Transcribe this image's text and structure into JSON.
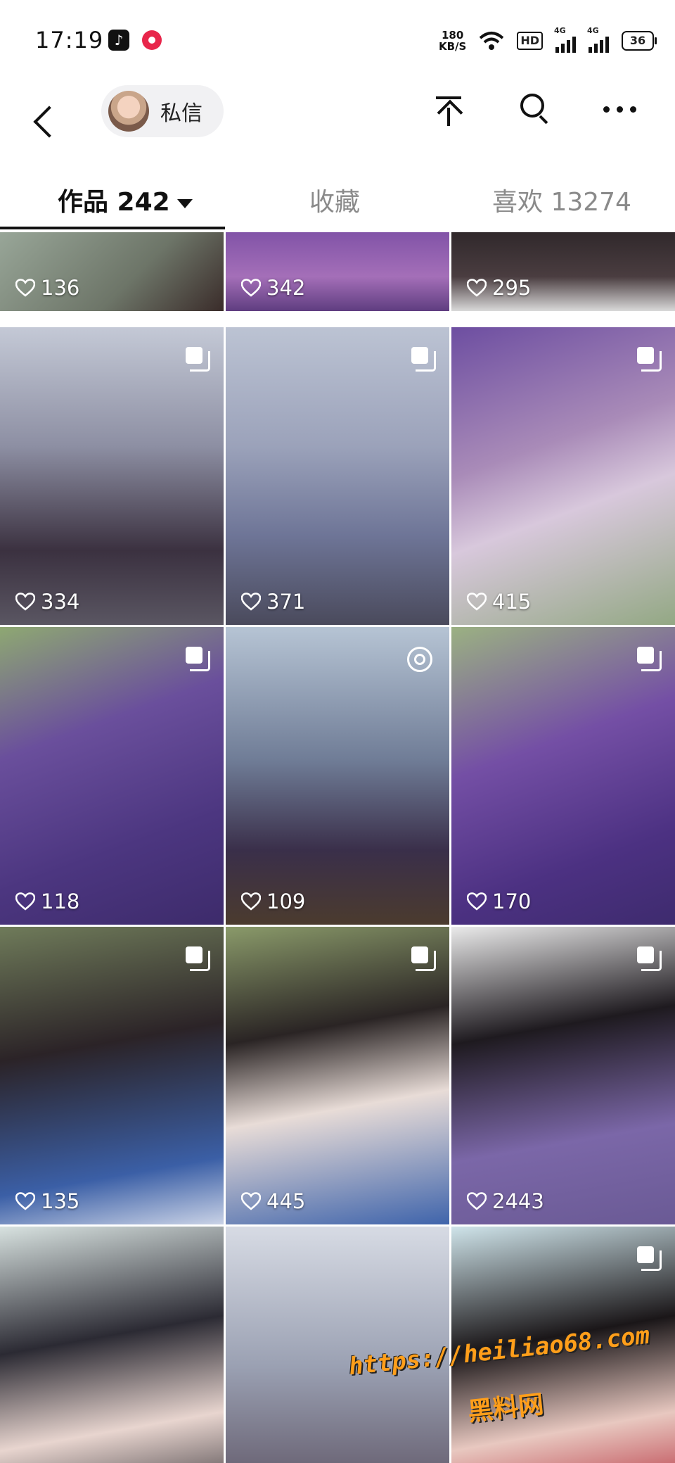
{
  "status_bar": {
    "time": "17:19",
    "net_speed_value": "180",
    "net_speed_unit": "KB/S",
    "hd_label": "HD",
    "signal_label": "4G",
    "battery": "36"
  },
  "header": {
    "dm_label": "私信"
  },
  "tabs": {
    "works": "作品 242",
    "favorites": "收藏",
    "likes": "喜欢 13274"
  },
  "grid": {
    "items": [
      {
        "likes": "136"
      },
      {
        "likes": "342"
      },
      {
        "likes": "295"
      },
      {
        "likes": "334"
      },
      {
        "likes": "371"
      },
      {
        "likes": "415"
      },
      {
        "likes": "118"
      },
      {
        "likes": "109"
      },
      {
        "likes": "170"
      },
      {
        "likes": "135"
      },
      {
        "likes": "445"
      },
      {
        "likes": "2443"
      },
      {
        "likes": ""
      },
      {
        "likes": ""
      },
      {
        "likes": ""
      }
    ]
  },
  "watermark": {
    "url": "https://heiliao68.com",
    "name": "黑料网"
  },
  "colors": {
    "accent": "#111111",
    "tab_inactive": "#8a8a8a",
    "watermark": "#ff9e1a"
  }
}
